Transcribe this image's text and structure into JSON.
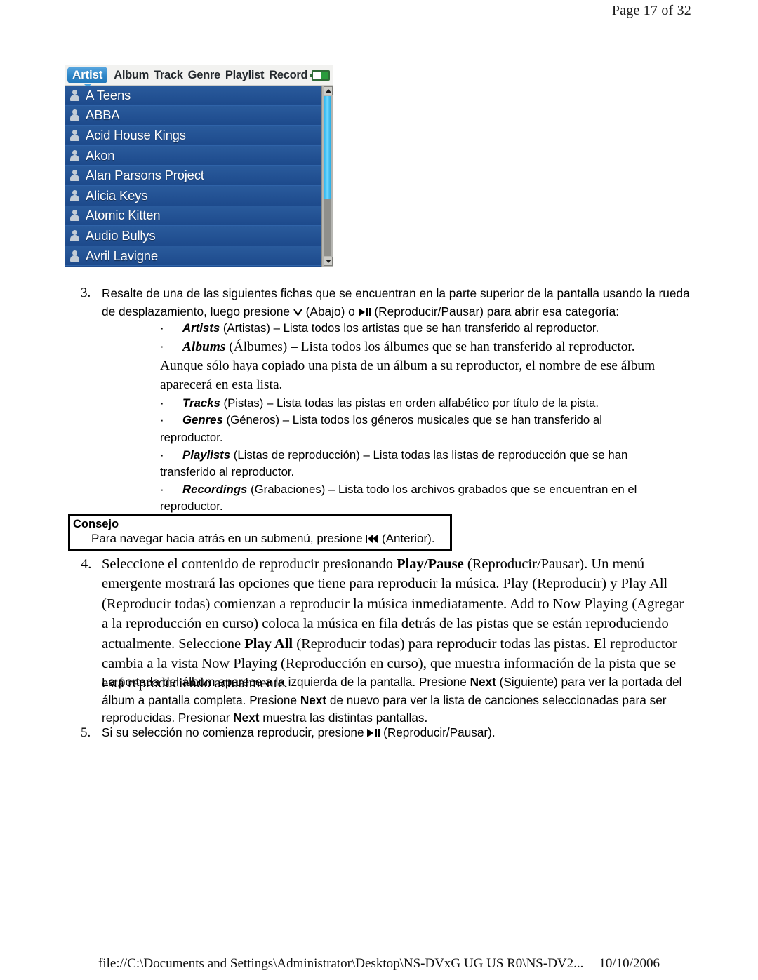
{
  "header": {
    "page_label": "Page 17 of 32"
  },
  "device_screenshot": {
    "active_tab": "Artist",
    "inactive_tabs": [
      "Album",
      "Track",
      "Genre",
      "Playlist",
      "Record"
    ],
    "battery_icon": "battery-icon",
    "list_items": [
      "A Teens",
      "ABBA",
      "Acid House Kings",
      "Akon",
      "Alan Parsons Project",
      "Alicia Keys",
      "Atomic Kitten",
      "Audio Bullys",
      "Avril Lavigne"
    ],
    "scroll_up_arrow": "▲",
    "scroll_down_arrow": "▼",
    "colors": {
      "tab_active": "#2e86c8",
      "list_background": "#1f4d8f",
      "scroll_thumb": "#2fb6ee",
      "battery_fill": "#2a9b3c"
    }
  },
  "step3": {
    "number": "3.",
    "text_before_down": "Resalte de una de las siguientes fichas que se encuentran en la parte superior de la pantalla usando la rueda de desplazamiento, luego presione ",
    "down_label": " (Abajo) o ",
    "playpause_label": " (Reproducir/Pausar) para abrir esa categoría:"
  },
  "bullets": [
    {
      "marker": "·",
      "lead": "Artists",
      "rest": " (Artistas) – Lista todos los artistas que se han transferido al reproductor.",
      "continuation": "",
      "style": "sans"
    },
    {
      "marker": "·",
      "lead": "Albums",
      "rest": " (Álbumes) – Lista todos los álbumes que se han transferido al reproductor.",
      "continuation": "Aunque sólo haya copiado una pista de un álbum a su reproductor, el nombre de ese álbum aparecerá en esta lista.",
      "style": "serif"
    },
    {
      "marker": "·",
      "lead": "Tracks",
      "rest": " (Pistas) – Lista todas las pistas en orden alfabético por título de la pista.",
      "continuation": "",
      "style": "sans"
    },
    {
      "marker": "·",
      "lead": "Genres",
      "rest": " (Géneros) – Lista todos los géneros musicales que se han transferido al",
      "continuation": "reproductor.",
      "style": "sans"
    },
    {
      "marker": "·",
      "lead": "Playlists",
      "rest": " (Listas de reproducción) – Lista todas las listas de reproducción que se han",
      "continuation": "transferido al reproductor.",
      "style": "sans"
    },
    {
      "marker": "·",
      "lead": "Recordings",
      "rest": " (Grabaciones) – Lista todo los archivos grabados que se encuentran en el",
      "continuation": "reproductor.",
      "style": "sans"
    }
  ],
  "tip_box": {
    "title": "Consejo",
    "text_before": "Para navegar hacia atrás en un submenú, presione ",
    "text_after": " (Anterior)."
  },
  "step4": {
    "number": "4.",
    "p1_a": "Seleccione el contenido de reproducir presionando ",
    "p1_bold1": "Play/Pause",
    "p1_b": " (Reproducir/Pausar). Un menú emergente mostrará las opciones que tiene para reproducir la música. Play (Reproducir) y Play All (Reproducir todas) comienzan a reproducir la música inmediatamente. Add to Now Playing (Agregar a la reproducción en curso) coloca la música en fila detrás de las pistas que se están reproduciendo actualmente. Seleccione ",
    "p1_bold2": "Play All",
    "p1_c": " (Reproducir todas) para reproducir todas las pistas. El reproductor cambia a la vista Now Playing (Reproducción en curso), que muestra información de la pista que se está reproduciendo actualmente."
  },
  "para_next": {
    "a": "La portada del álbum aparece a la izquierda de la pantalla. Presione ",
    "bold1": "Next",
    "b": " (Siguiente) para ver la portada del álbum a pantalla completa. Presione ",
    "bold2": "Next",
    "c": " de nuevo para ver la lista de canciones seleccionadas para ser reproducidas. Presionar ",
    "bold3": "Next",
    "d": " muestra las distintas pantallas."
  },
  "step5": {
    "number": "5.",
    "text_before": "Si su selección no comienza reproducir, presione ",
    "text_after": " (Reproducir/Pausar)."
  },
  "footer": {
    "path": "file://C:\\Documents and Settings\\Administrator\\Desktop\\NS-DVxG UG US R0\\NS-DV2...",
    "date": "10/10/2006"
  }
}
